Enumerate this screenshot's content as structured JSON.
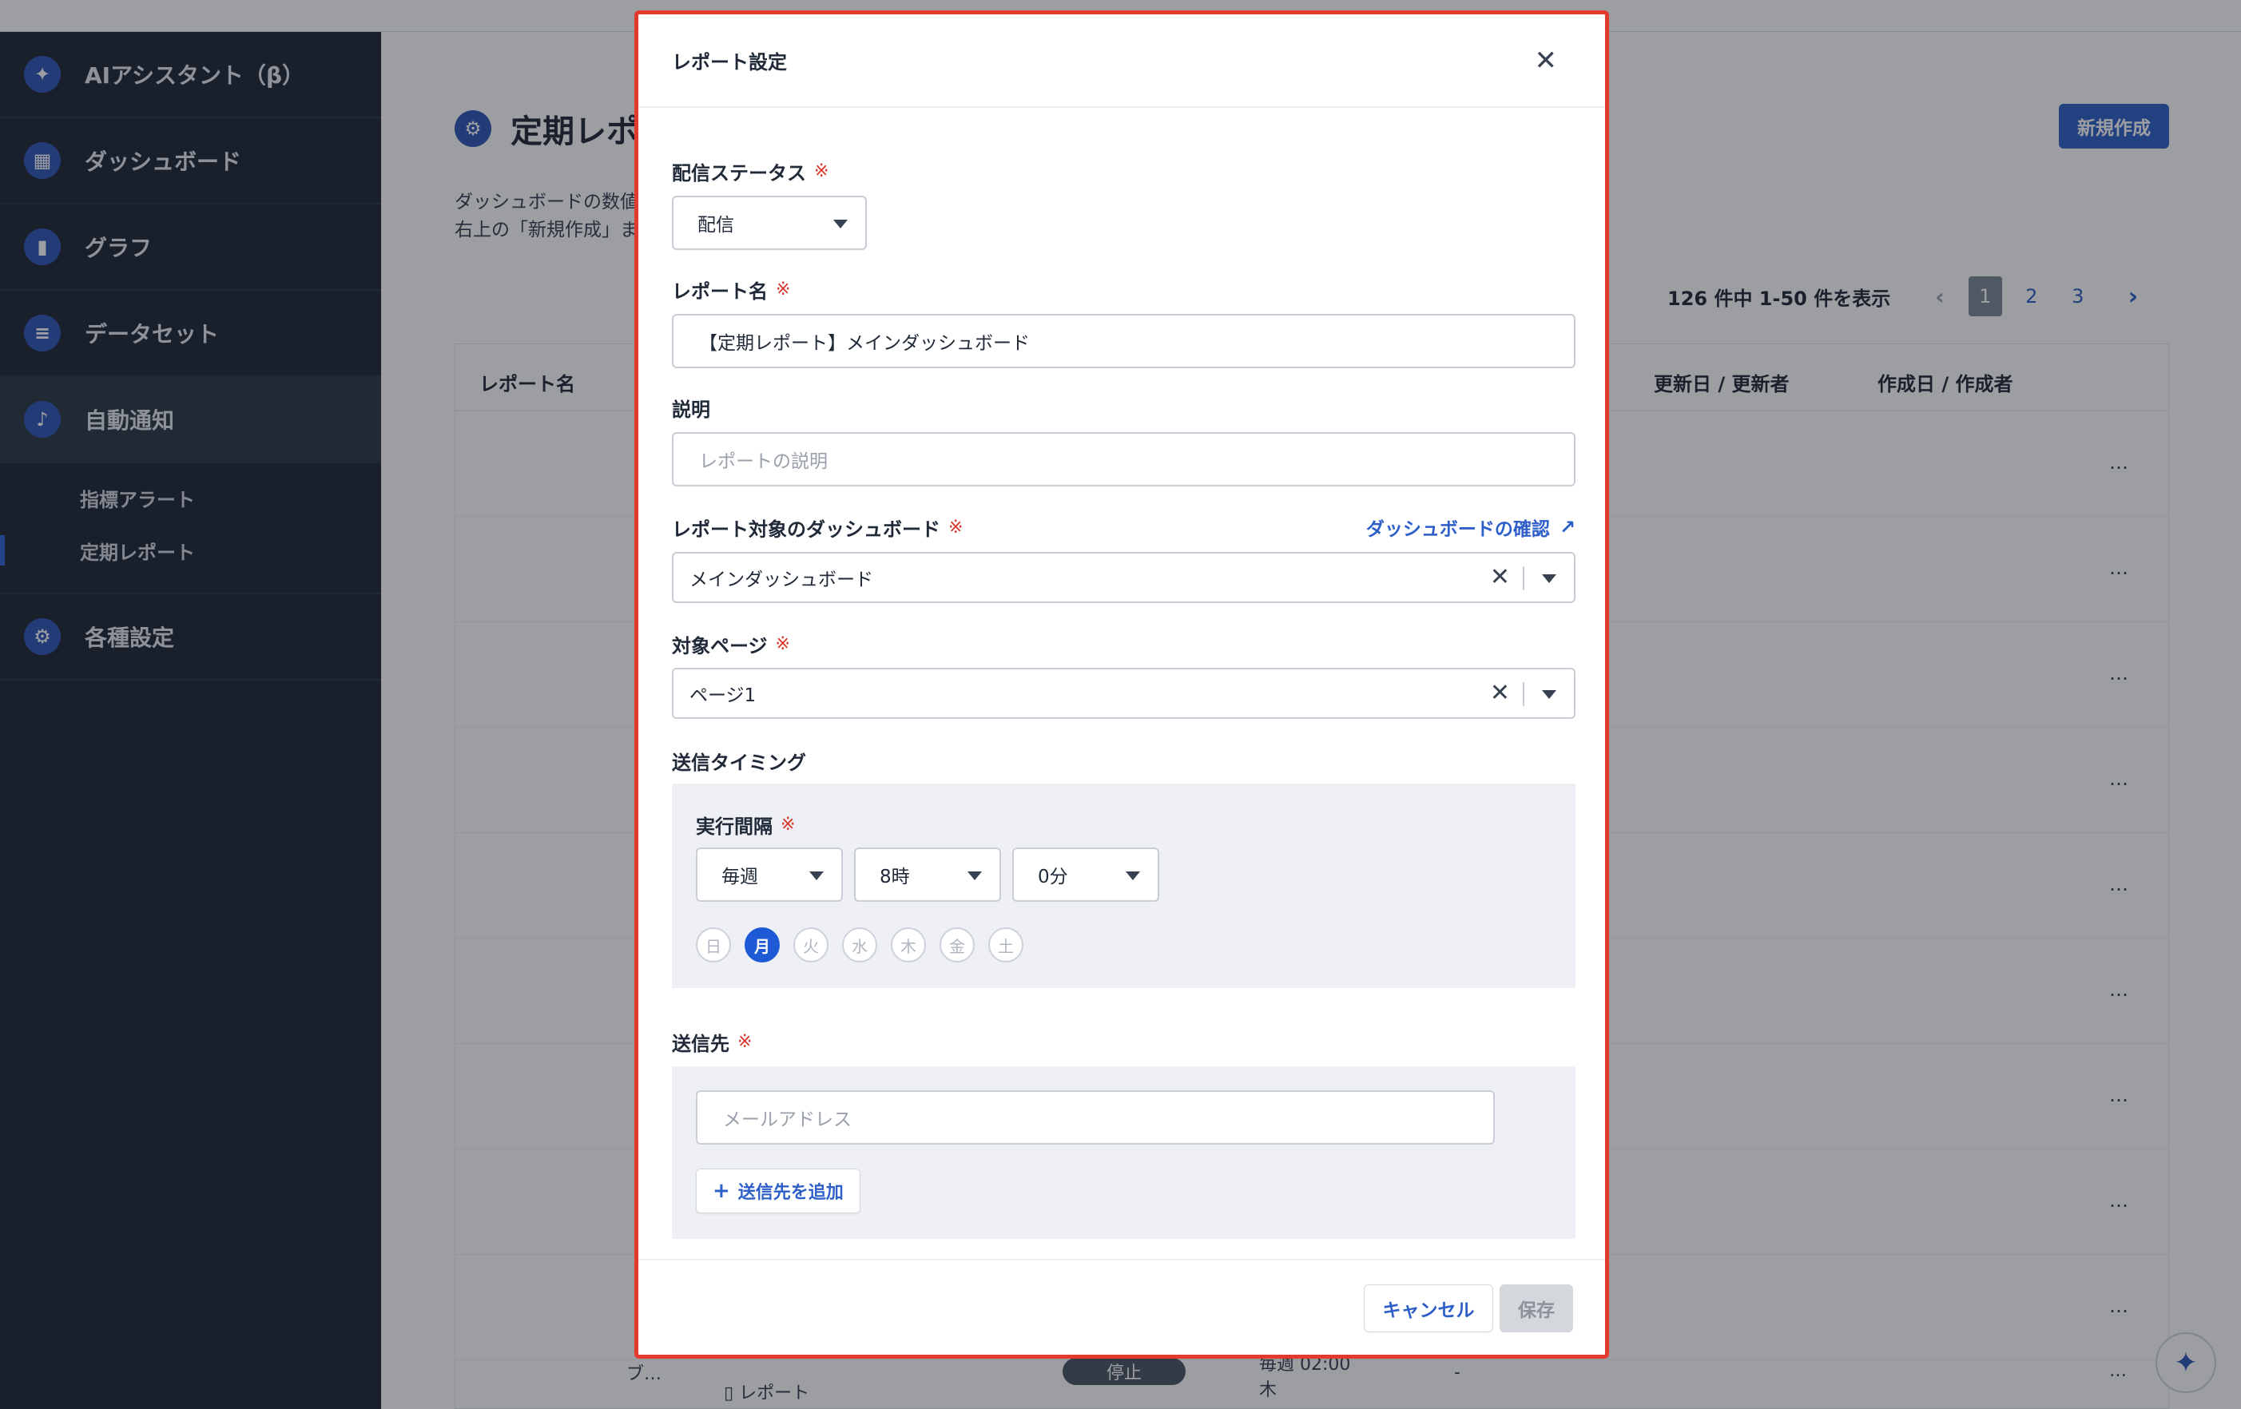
{
  "sidebar": {
    "items": [
      {
        "label": "AIアシスタント（β）",
        "icon": "sparkle-icon"
      },
      {
        "label": "ダッシュボード",
        "icon": "grid-icon"
      },
      {
        "label": "グラフ",
        "icon": "bar-chart-icon"
      },
      {
        "label": "データセット",
        "icon": "database-icon"
      },
      {
        "label": "自動通知",
        "icon": "bell-icon"
      },
      {
        "label": "各種設定",
        "icon": "gear-icon"
      }
    ],
    "sub_items": [
      "指標アラート",
      "定期レポート"
    ]
  },
  "main": {
    "title": "定期レポ",
    "desc_line1": "ダッシュボードの数値",
    "desc_line2": "右上の「新規作成」ま",
    "new_button": "新規作成",
    "pager": {
      "summary": "126 件中 1-50 件を表示",
      "pages": [
        "1",
        "2",
        "3"
      ],
      "current": "1"
    },
    "table_headers": {
      "name": "レポート名",
      "updated": "更新日 / 更新者",
      "created": "作成日 / 作成者"
    },
    "row_menu": "…",
    "bottom_fragments": {
      "row_name": "ブ…",
      "type": "レポート",
      "status": "停止",
      "schedule": "毎週 02:00",
      "schedule_day": "木",
      "dash": "-"
    }
  },
  "modal": {
    "title": "レポート設定",
    "required_mark": "※",
    "status_label": "配信ステータス",
    "status_value": "配信",
    "name_label": "レポート名",
    "name_value": "【定期レポート】メインダッシュボード",
    "desc_label": "説明",
    "desc_placeholder": "レポートの説明",
    "dashboard_label": "レポート対象のダッシュボード",
    "dashboard_link": "ダッシュボードの確認",
    "dashboard_value": "メインダッシュボード",
    "page_label": "対象ページ",
    "page_value": "ページ1",
    "timing_label": "送信タイミング",
    "interval_label": "実行間隔",
    "interval_freq": "毎週",
    "interval_hour": "8時",
    "interval_min": "0分",
    "days": [
      "日",
      "月",
      "火",
      "水",
      "木",
      "金",
      "土"
    ],
    "selected_day": "月",
    "recipients_label": "送信先",
    "email_placeholder": "メールアドレス",
    "add_recipient": "送信先を追加",
    "cancel": "キャンセル",
    "save": "保存"
  },
  "colors": {
    "accent": "#2e5fc9",
    "sidebar_bg": "#1e2736",
    "modal_border": "#e23b2e",
    "required": "#d9342b"
  }
}
